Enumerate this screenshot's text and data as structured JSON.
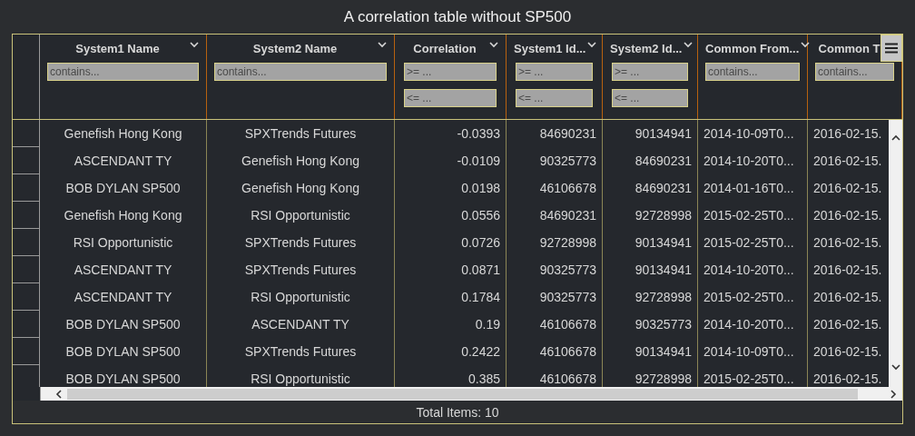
{
  "title": "A correlation table without SP500",
  "columns": [
    {
      "name": "System1 Name",
      "kind": "text",
      "filters": [
        {
          "placeholder": "contains..."
        }
      ]
    },
    {
      "name": "System2 Name",
      "kind": "text",
      "filters": [
        {
          "placeholder": "contains..."
        }
      ]
    },
    {
      "name": "Correlation",
      "kind": "number",
      "filters": [
        {
          "placeholder": ">= ..."
        },
        {
          "placeholder": "<= ..."
        }
      ]
    },
    {
      "name": "System1 Id...",
      "kind": "number",
      "filters": [
        {
          "placeholder": ">= ..."
        },
        {
          "placeholder": "<= ..."
        }
      ]
    },
    {
      "name": "System2 Id...",
      "kind": "number",
      "filters": [
        {
          "placeholder": ">= ..."
        },
        {
          "placeholder": "<= ..."
        }
      ]
    },
    {
      "name": "Common From...",
      "kind": "date",
      "filters": [
        {
          "placeholder": "contains..."
        }
      ]
    },
    {
      "name": "Common T",
      "kind": "date",
      "filters": [
        {
          "placeholder": "contains..."
        }
      ]
    }
  ],
  "rows": [
    {
      "cells": [
        "Genefish Hong Kong",
        "SPXTrends Futures",
        "-0.0393",
        "84690231",
        "90134941",
        "2014-10-09T0...",
        "2016-02-15."
      ]
    },
    {
      "cells": [
        "ASCENDANT TY",
        "Genefish Hong Kong",
        "-0.0109",
        "90325773",
        "84690231",
        "2014-10-20T0...",
        "2016-02-15."
      ]
    },
    {
      "cells": [
        "BOB DYLAN SP500",
        "Genefish Hong Kong",
        "0.0198",
        "46106678",
        "84690231",
        "2014-01-16T0...",
        "2016-02-15."
      ]
    },
    {
      "cells": [
        "Genefish Hong Kong",
        "RSI Opportunistic",
        "0.0556",
        "84690231",
        "92728998",
        "2015-02-25T0...",
        "2016-02-15."
      ]
    },
    {
      "cells": [
        "RSI Opportunistic",
        "SPXTrends Futures",
        "0.0726",
        "92728998",
        "90134941",
        "2015-02-25T0...",
        "2016-02-15."
      ]
    },
    {
      "cells": [
        "ASCENDANT TY",
        "SPXTrends Futures",
        "0.0871",
        "90325773",
        "90134941",
        "2014-10-20T0...",
        "2016-02-15."
      ]
    },
    {
      "cells": [
        "ASCENDANT TY",
        "RSI Opportunistic",
        "0.1784",
        "90325773",
        "92728998",
        "2015-02-25T0...",
        "2016-02-15."
      ]
    },
    {
      "cells": [
        "BOB DYLAN SP500",
        "ASCENDANT TY",
        "0.19",
        "46106678",
        "90325773",
        "2014-10-20T0...",
        "2016-02-15."
      ]
    },
    {
      "cells": [
        "BOB DYLAN SP500",
        "SPXTrends Futures",
        "0.2422",
        "46106678",
        "90134941",
        "2014-10-09T0...",
        "2016-02-15."
      ]
    },
    {
      "cells": [
        "BOB DYLAN SP500",
        "RSI Opportunistic",
        "0.385",
        "46106678",
        "92728998",
        "2015-02-25T0...",
        "2016-02-15."
      ]
    }
  ],
  "footer": "Total Items: 10"
}
